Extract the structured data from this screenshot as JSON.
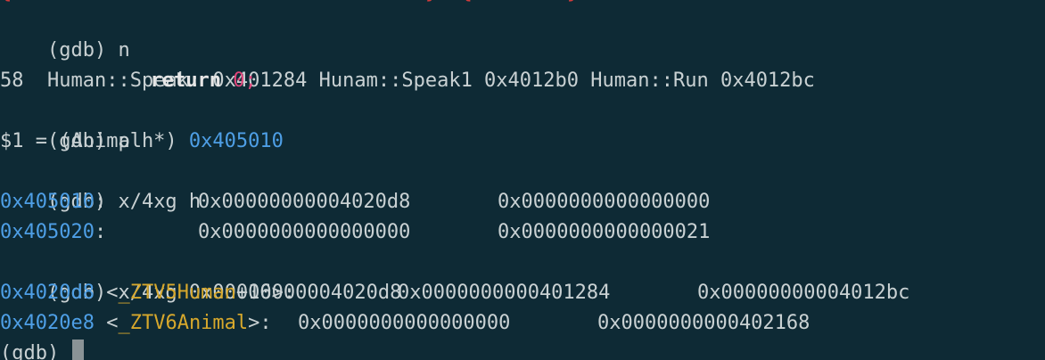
{
  "terminal": {
    "top_partial": "{  .  .  .  .  .  .  .  .  .  .  .  }  {  .  .  }",
    "line1_prompt": "(gdb) n",
    "line2": "Human::Speak: 0x401284 Hunam::Speak1 0x4012b0 Human::Run 0x4012bc",
    "line3_num": "58",
    "line3_kw": "return",
    "line3_zero": "0",
    "line3_semi": ";",
    "line4_prompt": "(gdb) p h",
    "line5_prefix": "$1 = (Animal *) ",
    "line5_addr": "0x405010",
    "line6_prompt": "(gdb) x/4xg h",
    "mem1_addr": "0x405010",
    "mem1_colon": ":",
    "mem1_v1": "0x00000000004020d8",
    "mem1_v2": "0x0000000000000000",
    "mem2_addr": "0x405020",
    "mem2_colon": ":",
    "mem2_v1": "0x0000000000000000",
    "mem2_v2": "0x0000000000000021",
    "line9_prompt": "(gdb) x/4xg 0x00000000004020d8",
    "vt1_addr": "0x4020d8",
    "vt1_lt": " <",
    "vt1_sym": "_ZTV5Human",
    "vt1_off": "+16>:",
    "vt1_v1": "0x0000000000401284",
    "vt1_v2": "0x00000000004012bc",
    "vt2_addr": "0x4020e8",
    "vt2_lt": " <",
    "vt2_sym": "_ZTV6Animal",
    "vt2_gt": ">: ",
    "vt2_v1": "0x0000000000000000",
    "vt2_v2": "0x0000000000402168",
    "last_prompt": "(gdb) "
  },
  "colors": {
    "background": "#0e2a35",
    "text": "#c9d1d3",
    "address": "#4e9fe6",
    "symbol": "#d7a82c",
    "number": "#e0457b"
  }
}
